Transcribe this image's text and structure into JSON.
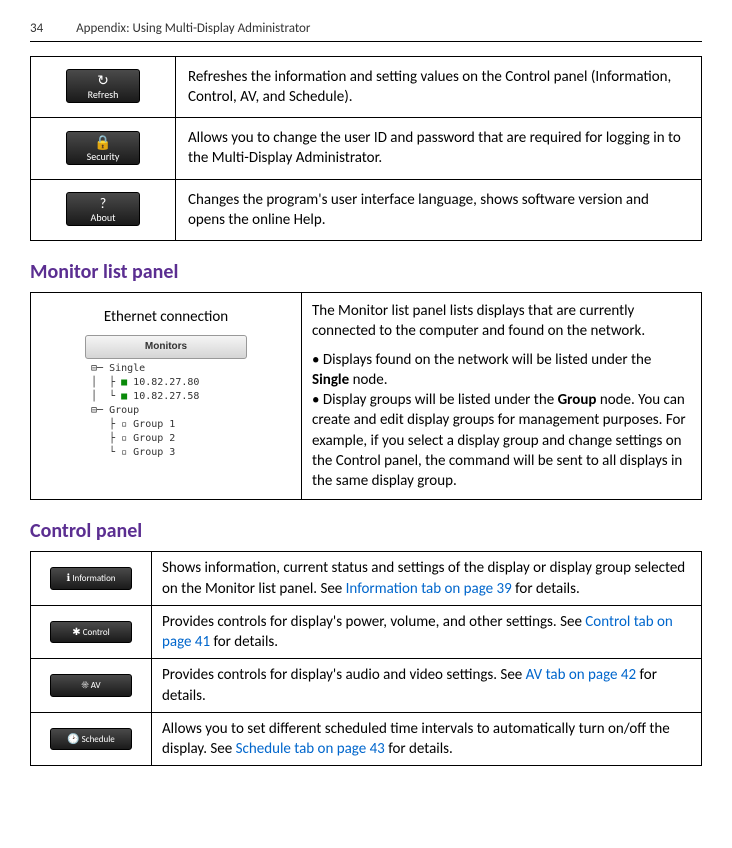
{
  "header": {
    "page": "34",
    "title": "Appendix: Using Multi-Display Administrator"
  },
  "topTable": [
    {
      "iconLabel": "Refresh",
      "glyph": "↻",
      "desc": "Refreshes the information and setting values on the Control panel (Information, Control, AV, and Schedule)."
    },
    {
      "iconLabel": "Security",
      "glyph": "🔒",
      "desc": "Allows you to change the user ID and password that are required for logging in to the Multi-Display Administrator."
    },
    {
      "iconLabel": "About",
      "glyph": "?",
      "desc": "Changes the program's user interface language, shows software version and opens the online Help."
    }
  ],
  "sections": {
    "monitor": "Monitor list panel",
    "control": "Control panel"
  },
  "monitorPanel": {
    "leftLabel": "Ethernet connection",
    "treeHeader": "Monitors",
    "tree": {
      "single": "Single",
      "ip1": "10.82.27.80",
      "ip2": "10.82.27.58",
      "group": "Group",
      "g1": "Group 1",
      "g2": "Group 2",
      "g3": "Group 3"
    },
    "right": {
      "intro": "The Monitor list panel lists displays that are currently connected to the computer and found on the network.",
      "b1a": "• Displays found on the network will be listed under the ",
      "b1b": "Single",
      "b1c": " node.",
      "b2a": "• Display groups will be listed under the ",
      "b2b": "Group",
      "b2c": " node. You can create and edit display groups for management purposes. For example, if you select a display group and change settings on the Control panel, the command will be sent to all displays in the same display group."
    }
  },
  "controlTable": [
    {
      "label": "Information",
      "glyph": "ℹ",
      "p1": "Shows information, current status and settings of the display or display group selected on the Monitor list panel. See ",
      "link": "Information tab on page 39",
      "p2": " for details."
    },
    {
      "label": "Control",
      "glyph": "✱",
      "p1": "Provides controls for display's power, volume, and other settings. See ",
      "link": "Control tab on page 41",
      "p2": " for details."
    },
    {
      "label": "AV",
      "glyph": "☀",
      "p1": "Provides controls for display's audio and video settings. See ",
      "link": "AV tab on page 42",
      "p2": " for details."
    },
    {
      "label": "Schedule",
      "glyph": "🕑",
      "p1": "Allows you to set different scheduled time intervals to automatically turn on/off the display. See ",
      "link": "Schedule tab on page 43",
      "p2": " for details."
    }
  ]
}
